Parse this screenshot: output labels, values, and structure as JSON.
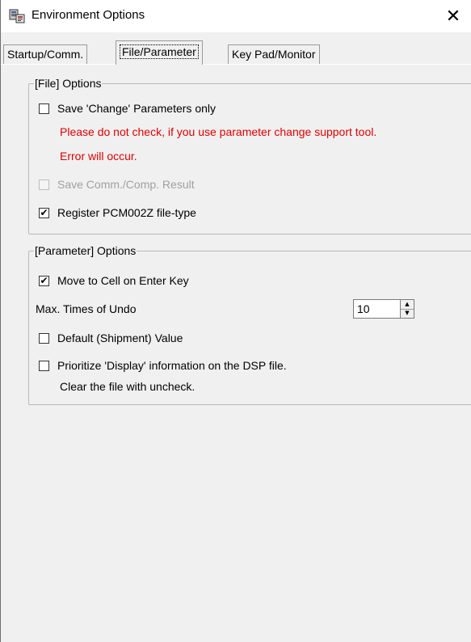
{
  "window": {
    "title": "Environment Options",
    "close_glyph": "✕",
    "app_icon": "app-window-icon"
  },
  "tabs": [
    {
      "label": "Startup/Comm.",
      "active": false
    },
    {
      "label": "File/Parameter",
      "active": true
    },
    {
      "label": "Key Pad/Monitor",
      "active": false
    }
  ],
  "file_options": {
    "title": "[File] Options",
    "save_change_only": {
      "label": "Save 'Change' Parameters only",
      "checked": false
    },
    "warning_line1": "Please do not check, if you use parameter change support tool.",
    "warning_line2": "Error will occur.",
    "save_comm_result": {
      "label": "Save Comm./Comp. Result",
      "checked": false,
      "disabled": true
    },
    "register_filetype": {
      "label": "Register PCM002Z file-type",
      "checked": true
    }
  },
  "parameter_options": {
    "title": "[Parameter] Options",
    "move_to_cell": {
      "label": "Move to Cell on Enter Key",
      "checked": true
    },
    "max_undo_label": "Max. Times of Undo",
    "max_undo_value": "10",
    "default_value": {
      "label": "Default (Shipment) Value",
      "checked": false
    },
    "prioritize_display": {
      "label": "Prioritize 'Display' information on the DSP file.",
      "checked": false
    },
    "prioritize_note": "Clear the file with uncheck."
  },
  "glyphs": {
    "check": "✔",
    "up": "▲",
    "down": "▼"
  },
  "colors": {
    "warning": "#e00000",
    "disabled": "#a0a0a0"
  }
}
